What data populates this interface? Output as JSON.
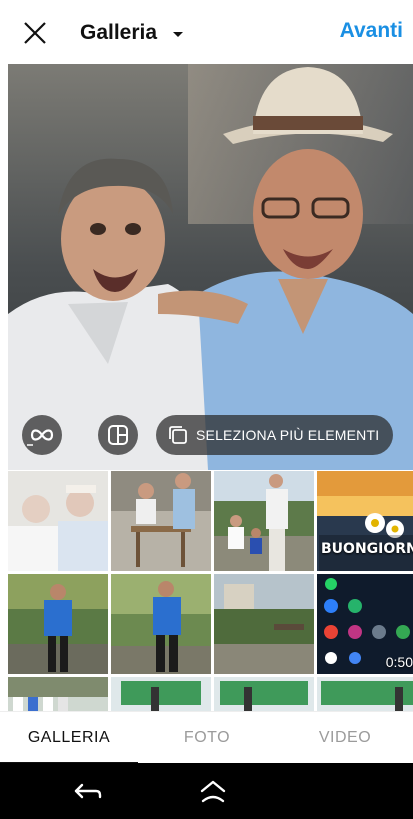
{
  "header": {
    "title": "Galleria",
    "next_label": "Avanti",
    "accent_color": "#1a8fe3",
    "close_icon": "close-icon",
    "dropdown_icon": "caret-down-icon"
  },
  "preview": {
    "buttons": {
      "boomerang_icon": "infinity-icon",
      "layout_icon": "layout-icon",
      "multi_select_icon": "multi-select-icon",
      "multi_select_label": "SELEZIONA PIÙ ELEMENTI"
    }
  },
  "grid": {
    "thumbnails": [
      {
        "kind": "photo",
        "subject": "two men"
      },
      {
        "kind": "photo",
        "subject": "man at table"
      },
      {
        "kind": "photo",
        "subject": "man with child"
      },
      {
        "kind": "image",
        "text": "BUONGIORNO"
      },
      {
        "kind": "photo",
        "subject": "man blue shirt"
      },
      {
        "kind": "photo",
        "subject": "man blue shirt"
      },
      {
        "kind": "photo",
        "subject": "garden"
      },
      {
        "kind": "video",
        "duration": "0:50"
      },
      {
        "kind": "photo",
        "subject": "crowd"
      },
      {
        "kind": "photo",
        "subject": "banner"
      },
      {
        "kind": "photo",
        "subject": "banner"
      },
      {
        "kind": "photo",
        "subject": "banner"
      }
    ]
  },
  "tabs": [
    {
      "label": "GALLERIA",
      "active": true
    },
    {
      "label": "FOTO",
      "active": false
    },
    {
      "label": "VIDEO",
      "active": false
    }
  ],
  "system_nav": {
    "back_icon": "back-arrow-icon",
    "home_icon": "home-icon"
  }
}
